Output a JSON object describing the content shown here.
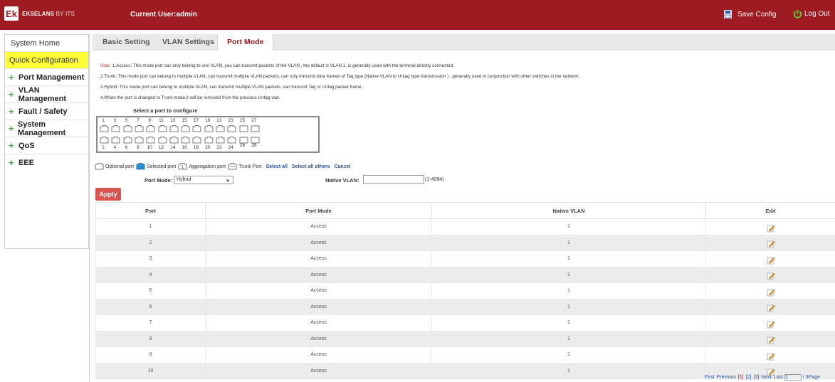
{
  "header": {
    "logo_mark": "Ek",
    "logo_name": "EKSELANS",
    "logo_sub": "BY ITS",
    "current_user": "Current User:admin",
    "save_config": "Save Config",
    "logout": "Log Out",
    "colors": {
      "brand": "#9e1b21"
    }
  },
  "sidebar": {
    "items": [
      {
        "label": "System Home",
        "type": "plain"
      },
      {
        "label": "Quick Configuration",
        "type": "quick"
      },
      {
        "label": "Port Management",
        "type": "group"
      },
      {
        "label": "VLAN Management",
        "type": "group"
      },
      {
        "label": "Fault / Safety",
        "type": "group"
      },
      {
        "label": "System Management",
        "type": "group"
      },
      {
        "label": "QoS",
        "type": "group"
      },
      {
        "label": "EEE",
        "type": "group"
      }
    ]
  },
  "tabs": [
    {
      "label": "Basic Setting"
    },
    {
      "label": "VLAN Settings"
    },
    {
      "label": "Port Mode",
      "active": true
    }
  ],
  "notes": {
    "label": "Note:",
    "line1": "1.Access: This mode port can only belong to one VLAN, you can transmit packets of the VLAN , the default is VLAN 1, is generally used with the terminal directly connected.",
    "line2": "2.Trunk: This mode port can belong to multiple VLAN, can transmit multiple VLAN packets, can only transmit data frames of Tag type (Native VLAN to Untag type transmission ) , generally used in conjunction with other switches in the network.",
    "line3": "3.Hybrid: This mode port can belong to multiple VLAN, can transmit multiple VLAN packets, can transmit Tag or Untag packet frame .",
    "line4": "4.When the port is changed to Trunk mode,it will be removed from the previous Untag vlan."
  },
  "port_selector": {
    "label": "Select a port to configure",
    "top_numbers": [
      "1",
      "3",
      "5",
      "7",
      "9",
      "11",
      "13",
      "15",
      "17",
      "19",
      "21",
      "23",
      "25",
      "27"
    ],
    "bottom_numbers": [
      "2",
      "4",
      "6",
      "8",
      "10",
      "12",
      "14",
      "16",
      "18",
      "20",
      "22",
      "24",
      "26",
      "28"
    ]
  },
  "legend": {
    "optional": "Optional port",
    "selected": "Selected port",
    "aggregation": "Aggregation port",
    "trunk": "Trunk Port",
    "select_all": "Select all",
    "select_all_others": "Select all others",
    "cancel": "Cancel"
  },
  "form": {
    "port_mode_label": "Port Mode:",
    "port_mode_value": "Hybrid",
    "native_vlan_label": "Native VLAN:",
    "native_vlan_value": "",
    "native_vlan_hint": "(1-4094)",
    "apply": "Apply"
  },
  "table": {
    "headers": [
      "Port",
      "Port Mode",
      "Native VLAN",
      "Edit"
    ],
    "rows": [
      {
        "port": "1",
        "mode": "Access",
        "vlan": "1"
      },
      {
        "port": "2",
        "mode": "Access",
        "vlan": "1"
      },
      {
        "port": "3",
        "mode": "Access",
        "vlan": "1"
      },
      {
        "port": "4",
        "mode": "Access",
        "vlan": "1"
      },
      {
        "port": "5",
        "mode": "Access",
        "vlan": "1"
      },
      {
        "port": "6",
        "mode": "Access",
        "vlan": "1"
      },
      {
        "port": "7",
        "mode": "Access",
        "vlan": "1"
      },
      {
        "port": "8",
        "mode": "Access",
        "vlan": "1"
      },
      {
        "port": "9",
        "mode": "Access",
        "vlan": "1"
      },
      {
        "port": "10",
        "mode": "Access",
        "vlan": "1"
      }
    ]
  },
  "pagination": {
    "first": "First",
    "previous": "Previous",
    "pages": [
      "[1]",
      "[2]",
      "[3]"
    ],
    "current": "[1]",
    "next": "Next",
    "last": "Last",
    "page_input": "1",
    "total": "/ 3Page"
  }
}
